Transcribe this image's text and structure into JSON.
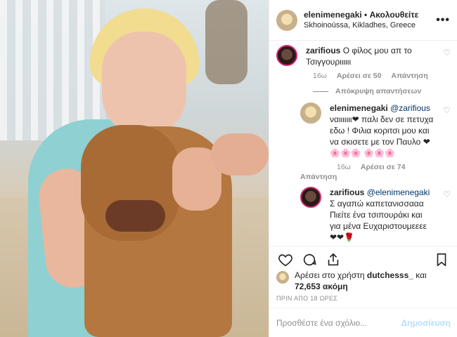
{
  "header": {
    "username": "elenimenegaki",
    "separator": " • ",
    "follow_label": "Ακολουθείτε",
    "location": "Skhoinoússa, Kikladhes, Greece"
  },
  "comments": [
    {
      "username": "zarifious",
      "text": "Ο φίλος μου απ το Τσιγγουριιιιιι",
      "time": "16ω",
      "likes": "Αρέσει σε 50",
      "reply_label": "Απάντηση",
      "hide_label": "Απόκρυψη απαντήσεων",
      "replies": [
        {
          "username": "elenimenegaki",
          "mention": "@zarifious",
          "text": "ναιιιιιιι❤ παλι δεν σε πετυχα εδω ! Φιλια κοριτσι μου και να σκισετε με τον Παυλο ❤ 🌸🌸🌸 🌸🌸🌸",
          "time": "16ω",
          "likes": "Αρέσει σε 74",
          "reply_label": "Απάντηση"
        },
        {
          "username": "zarifious",
          "mention": "@elenimenegaki",
          "text": "Σ αγαπώ καπετανισσααα Πιείτε ένα τσιπουράκι και για μένα Ευχαριστουμεεεε ❤❤🌹"
        }
      ]
    }
  ],
  "likes": {
    "prefix": "Αρέσει στο χρήστη",
    "user": "dutchesss_",
    "and": "και",
    "count": "72,653 ακόμη"
  },
  "timestamp": "ΠΡΙΝ ΑΠΟ 18 ΩΡΕΣ",
  "add_comment": {
    "placeholder": "Προσθέστε ένα σχόλιο...",
    "publish_label": "Δημοσίευση"
  },
  "colors": {
    "link": "#003569",
    "muted": "#8e8e8e",
    "publish_disabled": "#b2dffc"
  }
}
